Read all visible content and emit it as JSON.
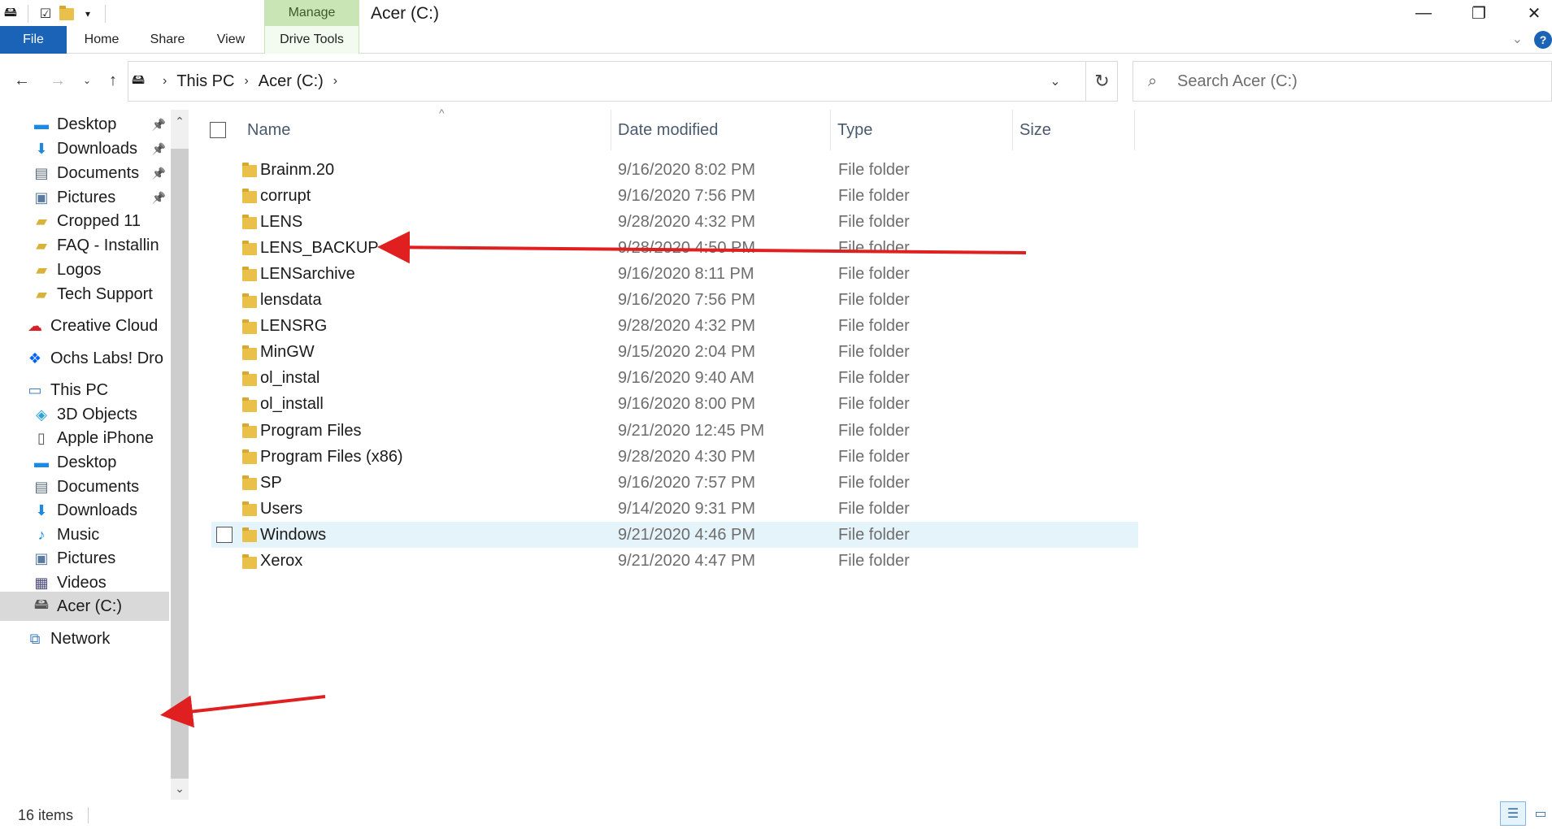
{
  "window": {
    "title": "Acer (C:)",
    "manage_label": "Manage",
    "minimize": "—",
    "restore": "❐",
    "close": "✕"
  },
  "ribbon": {
    "tabs": [
      "File",
      "Home",
      "Share",
      "View",
      "Drive Tools"
    ],
    "collapse_glyph": "⌄",
    "help_glyph": "?"
  },
  "address": {
    "crumbs": [
      "This PC",
      "Acer (C:)"
    ],
    "search_placeholder": "Search Acer (C:)"
  },
  "nav_pane": {
    "items": [
      {
        "label": "Desktop",
        "icon": "desktop-icon",
        "pinned": true
      },
      {
        "label": "Downloads",
        "icon": "download-icon",
        "pinned": true
      },
      {
        "label": "Documents",
        "icon": "documents-icon",
        "pinned": true
      },
      {
        "label": "Pictures",
        "icon": "pictures-icon",
        "pinned": true
      },
      {
        "label": "Cropped 11",
        "icon": "shared-folder-icon",
        "pinned": false
      },
      {
        "label": "FAQ - Installin",
        "icon": "shared-folder-icon",
        "pinned": false
      },
      {
        "label": "Logos",
        "icon": "shared-folder-icon",
        "pinned": false
      },
      {
        "label": "Tech Support",
        "icon": "shared-folder-icon",
        "pinned": false
      },
      {
        "label": "Creative Cloud",
        "icon": "creative-cloud-icon",
        "pinned": false
      },
      {
        "label": "Ochs Labs! Dro",
        "icon": "dropbox-icon",
        "pinned": false
      },
      {
        "label": "This PC",
        "icon": "computer-icon",
        "pinned": false
      },
      {
        "label": "3D Objects",
        "icon": "3d-objects-icon",
        "pinned": false
      },
      {
        "label": "Apple iPhone",
        "icon": "phone-icon",
        "pinned": false
      },
      {
        "label": "Desktop",
        "icon": "desktop-icon",
        "pinned": false
      },
      {
        "label": "Documents",
        "icon": "documents-icon",
        "pinned": false
      },
      {
        "label": "Downloads",
        "icon": "download-icon",
        "pinned": false
      },
      {
        "label": "Music",
        "icon": "music-icon",
        "pinned": false
      },
      {
        "label": "Pictures",
        "icon": "pictures-icon",
        "pinned": false
      },
      {
        "label": "Videos",
        "icon": "videos-icon",
        "pinned": false
      },
      {
        "label": "Acer (C:)",
        "icon": "drive-icon",
        "pinned": false
      },
      {
        "label": "Network",
        "icon": "network-icon",
        "pinned": false
      }
    ]
  },
  "columns": {
    "name": "Name",
    "date": "Date modified",
    "type": "Type",
    "size": "Size"
  },
  "files": [
    {
      "name": "Brainm.20",
      "date": "9/16/2020 8:02 PM",
      "type": "File folder"
    },
    {
      "name": "corrupt",
      "date": "9/16/2020 7:56 PM",
      "type": "File folder"
    },
    {
      "name": "LENS",
      "date": "9/28/2020 4:32 PM",
      "type": "File folder"
    },
    {
      "name": "LENS_BACKUP",
      "date": "9/28/2020 4:50 PM",
      "type": "File folder"
    },
    {
      "name": "LENSarchive",
      "date": "9/16/2020 8:11 PM",
      "type": "File folder"
    },
    {
      "name": "lensdata",
      "date": "9/16/2020 7:56 PM",
      "type": "File folder"
    },
    {
      "name": "LENSRG",
      "date": "9/28/2020 4:32 PM",
      "type": "File folder"
    },
    {
      "name": "MinGW",
      "date": "9/15/2020 2:04 PM",
      "type": "File folder"
    },
    {
      "name": "ol_instal",
      "date": "9/16/2020 9:40 AM",
      "type": "File folder"
    },
    {
      "name": "ol_install",
      "date": "9/16/2020 8:00 PM",
      "type": "File folder"
    },
    {
      "name": "Program Files",
      "date": "9/21/2020 12:45 PM",
      "type": "File folder"
    },
    {
      "name": "Program Files (x86)",
      "date": "9/28/2020 4:30 PM",
      "type": "File folder"
    },
    {
      "name": "SP",
      "date": "9/16/2020 7:57 PM",
      "type": "File folder"
    },
    {
      "name": "Users",
      "date": "9/14/2020 9:31 PM",
      "type": "File folder"
    },
    {
      "name": "Windows",
      "date": "9/21/2020 4:46 PM",
      "type": "File folder"
    },
    {
      "name": "Xerox",
      "date": "9/21/2020 4:47 PM",
      "type": "File folder"
    }
  ],
  "status": {
    "count": "16 items"
  },
  "colors": {
    "accent": "#1a63b6",
    "manage_tab": "#c9e5b6",
    "hover_row": "#e5f3fb",
    "annotation_arrow": "#e02020"
  }
}
